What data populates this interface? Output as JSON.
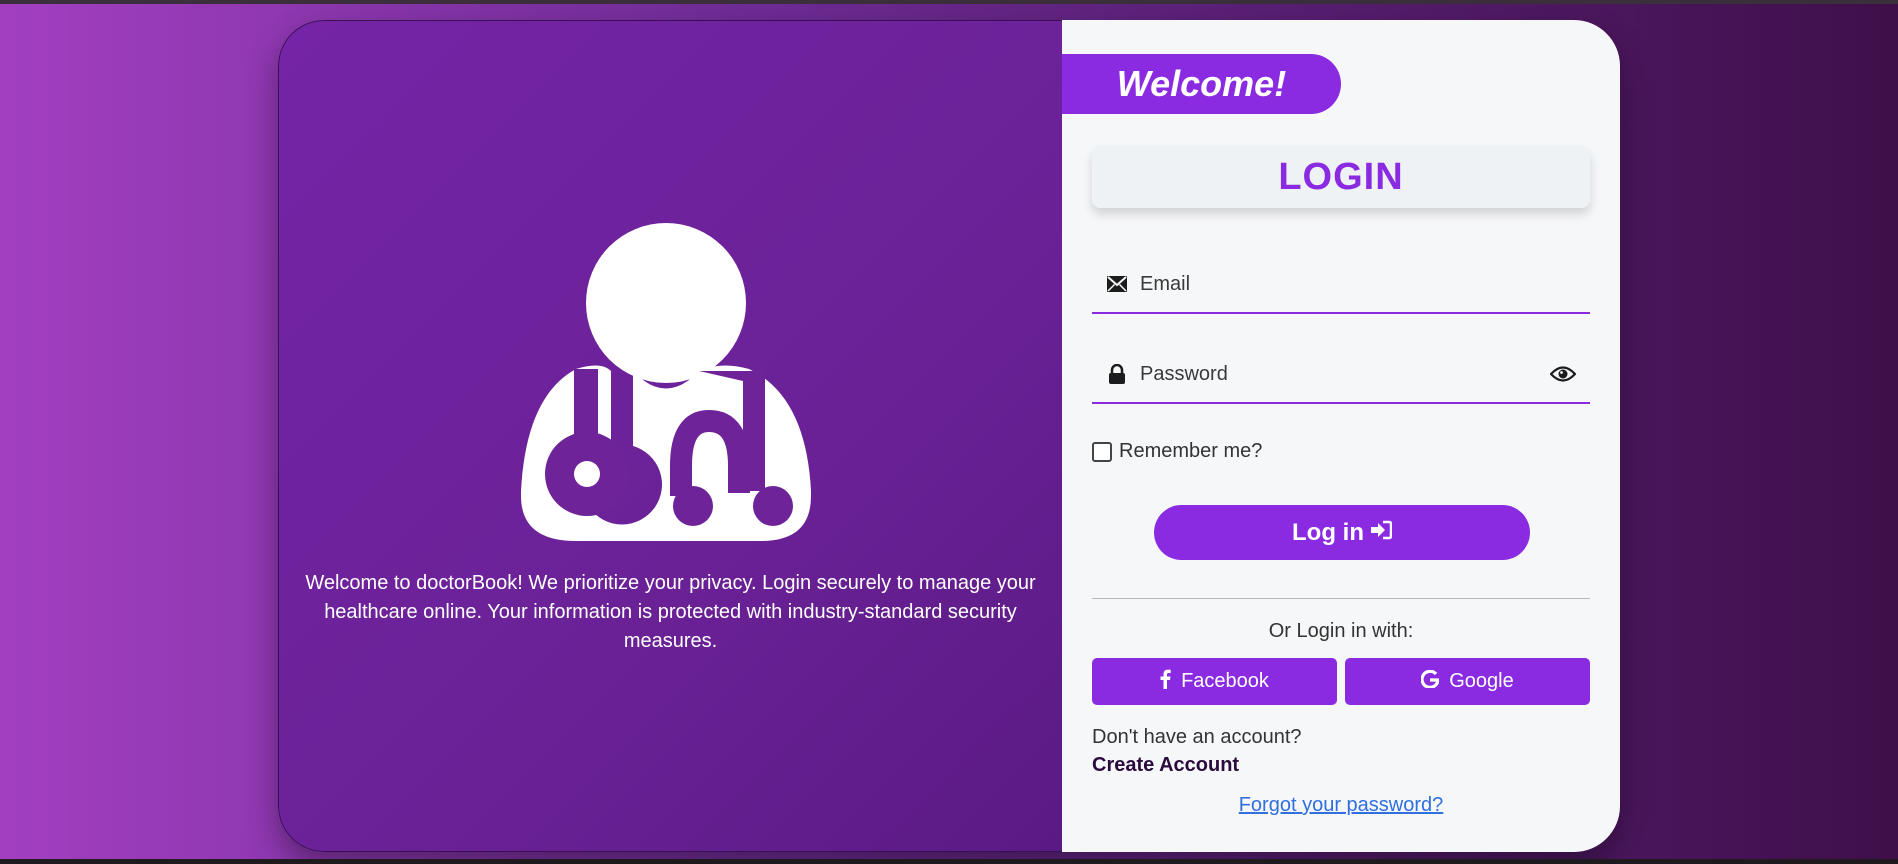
{
  "left_panel": {
    "illustration_icon": "doctor-with-stethoscope-icon",
    "welcome_text": "Welcome to doctorBook! We prioritize your privacy. Login securely to manage your healthcare online. Your information is protected with industry-standard security measures."
  },
  "right_panel": {
    "welcome_label": "Welcome!",
    "login_heading": "LOGIN",
    "email": {
      "icon": "envelope-icon",
      "placeholder": "Email",
      "value": ""
    },
    "password": {
      "icon": "lock-icon",
      "placeholder": "Password",
      "value": "",
      "toggle_icon": "eye-icon"
    },
    "remember_me": {
      "label": "Remember me?",
      "checked": false
    },
    "login_button": {
      "label": "Log in",
      "icon": "sign-in-icon"
    },
    "social": {
      "prompt": "Or Login in with:",
      "facebook_label": "Facebook",
      "google_label": "Google"
    },
    "no_account_text": "Don't have an account?",
    "create_account_label": "Create Account",
    "forgot_password_label": "Forgot your password?"
  },
  "colors": {
    "accent": "#8a2be2",
    "left_panel": "#6e2399",
    "link": "#2f6fe0",
    "background_start": "#a23fc1",
    "background_end": "#3f0f4a"
  }
}
